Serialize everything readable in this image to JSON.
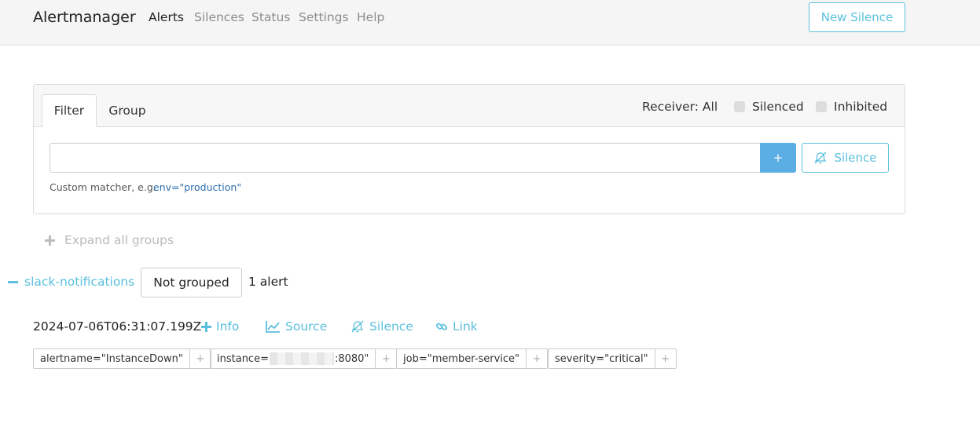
{
  "nav": {
    "brand": "Alertmanager",
    "links": [
      "Alerts",
      "Silences",
      "Status",
      "Settings",
      "Help"
    ],
    "new_silence": "New Silence"
  },
  "filter": {
    "tabs": [
      "Filter",
      "Group"
    ],
    "receiver": "Receiver: All",
    "silenced": "Silenced",
    "inhibited": "Inhibited",
    "input_value": "",
    "add_button": "+",
    "silence_button": "Silence",
    "hint": "Custom matcher, e.g.",
    "hint_example": "env=\"production\""
  },
  "expand_all": "Expand all groups",
  "group": {
    "receiver": "slack-notifications",
    "grouping": "Not grouped",
    "count": "1 alert"
  },
  "alert": {
    "timestamp": "2024-07-06T06:31:07.199Z",
    "actions": [
      "Info",
      "Source",
      "Silence",
      "Link"
    ],
    "labels": [
      {
        "pre": "alertname=\"InstanceDown\"",
        "post": ""
      },
      {
        "pre": "instance=",
        "post": ":8080\""
      },
      {
        "pre": "job=\"member-service\"",
        "post": ""
      },
      {
        "pre": "severity=\"critical\"",
        "post": ""
      }
    ],
    "label_add": "+"
  },
  "colors": {
    "accent": "#5bc0de",
    "primary": "#5aaee4",
    "link": "#2a6dad"
  }
}
